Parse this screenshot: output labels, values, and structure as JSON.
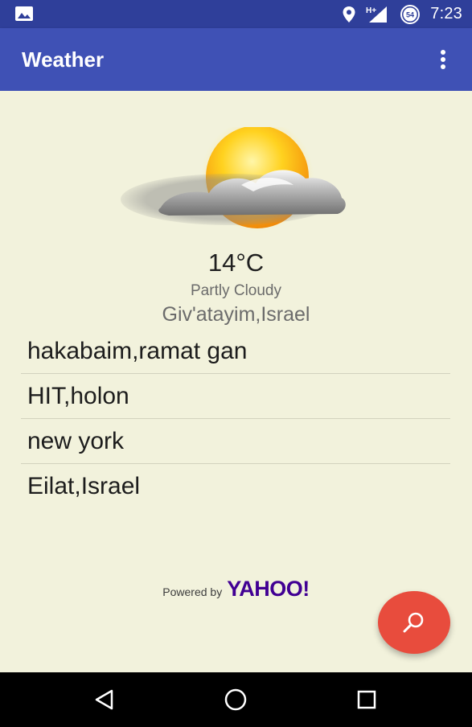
{
  "status_bar": {
    "time": "7:23",
    "network_label": "H+",
    "battery_level": "54",
    "icons": [
      "image-icon",
      "location-icon",
      "signal-icon",
      "battery-icon"
    ]
  },
  "app_bar": {
    "title": "Weather",
    "menu_icon": "more-vert-icon"
  },
  "current": {
    "icon": "partly-cloudy-icon",
    "temperature": "14°C",
    "condition": "Partly Cloudy",
    "location": "Giv'atayim,Israel"
  },
  "cities": [
    "hakabaim,ramat gan",
    "HIT,holon",
    "new york",
    "Eilat,Israel"
  ],
  "footer": {
    "powered_by": "Powered by",
    "brand": "YAHOO!"
  },
  "fab": {
    "icon": "search-icon"
  },
  "nav_bar": {
    "icons": [
      "back-icon",
      "home-icon",
      "recents-icon"
    ]
  },
  "colors": {
    "status_bar": "#2f3f9a",
    "app_bar": "#3f51b5",
    "background": "#f2f2dc",
    "fab": "#e84c3d",
    "yahoo": "#410093"
  }
}
